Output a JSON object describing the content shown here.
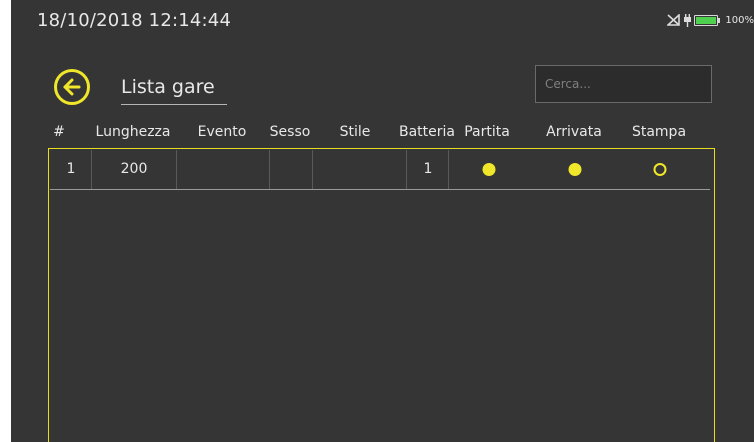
{
  "status": {
    "datetime": "18/10/2018  12:14:44",
    "battery_percent_label": "100%",
    "battery_level": 1.0,
    "battery_color": "#4fd04f",
    "icons": [
      "signal-icon",
      "plug-icon",
      "battery-icon"
    ]
  },
  "header": {
    "back_icon": "arrow-left-circle-icon",
    "title": "Lista gare",
    "accent_color": "#f0e62a"
  },
  "search": {
    "placeholder": "Cerca...",
    "value": ""
  },
  "table": {
    "columns": [
      "#",
      "Lunghezza",
      "Evento",
      "Sesso",
      "Stile",
      "Batteria",
      "Partita",
      "Arrivata",
      "Stampa"
    ],
    "rows": [
      {
        "num": "1",
        "lunghezza": "200",
        "evento": "",
        "sesso": "",
        "stile": "",
        "batteria": "1",
        "partita": true,
        "arrivata": true,
        "stampa": false
      }
    ]
  }
}
